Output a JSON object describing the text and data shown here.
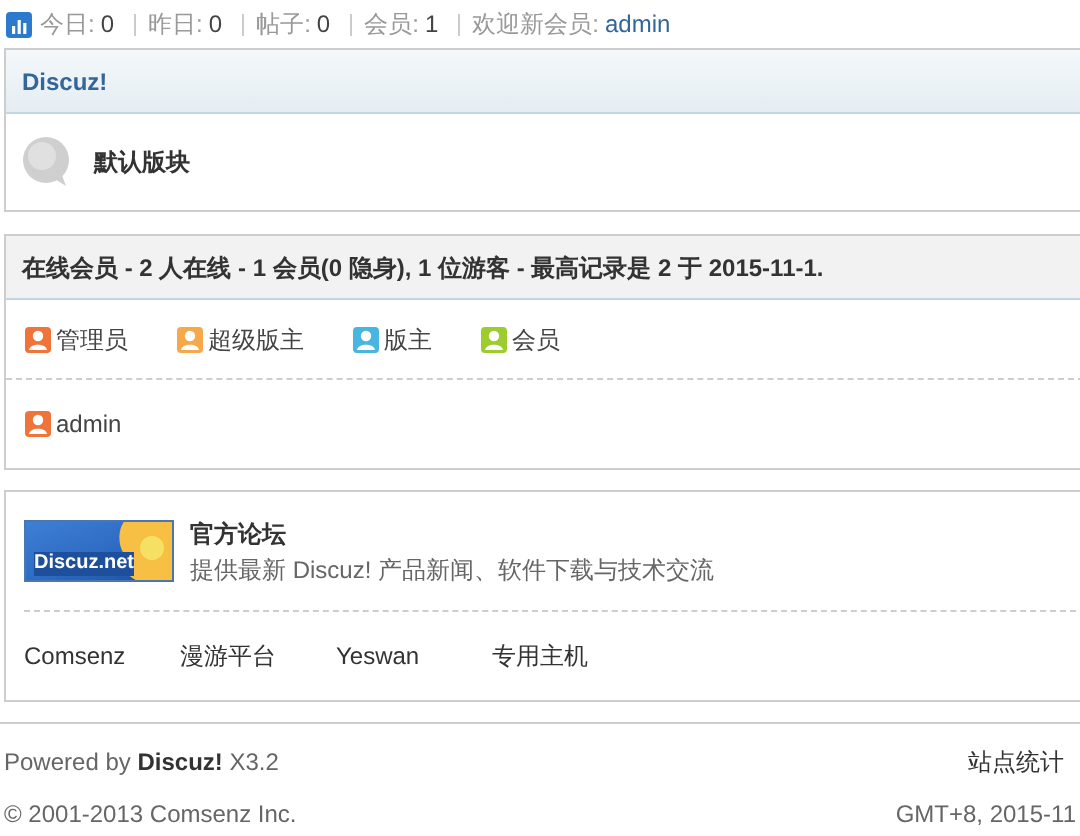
{
  "stats": [
    {
      "label": "今日:",
      "value": "0"
    },
    {
      "label": "昨日:",
      "value": "0"
    },
    {
      "label": "帖子:",
      "value": "0"
    },
    {
      "label": "会员:",
      "value": "1"
    },
    {
      "label": "欢迎新会员:",
      "value": "admin"
    }
  ],
  "category": {
    "title": "Discuz!",
    "forums": [
      {
        "name": "默认版块"
      }
    ]
  },
  "online": {
    "title": "在线会员 - 2 人在线 - 1 会员(0 隐身), 1 位游客 - 最高记录是 2 于 2015-11-1.",
    "legend": [
      {
        "label": "管理员",
        "color": "#f0743a"
      },
      {
        "label": "超级版主",
        "color": "#f5a94a"
      },
      {
        "label": "版主",
        "color": "#48b6e0"
      },
      {
        "label": "会员",
        "color": "#9ccc2e"
      }
    ],
    "users": [
      {
        "name": "admin",
        "color": "#f0743a"
      }
    ]
  },
  "links": {
    "featured": {
      "logo_text": "Discuz.net",
      "title": "官方论坛",
      "description": "提供最新 Discuz! 产品新闻、软件下载与技术交流"
    },
    "items": [
      "Comsenz",
      "漫游平台",
      "Yeswan",
      "专用主机"
    ]
  },
  "footer": {
    "powered_prefix": "Powered by",
    "brand": "Discuz!",
    "version": "X3.2",
    "copyright": "© 2001-2013 Comsenz Inc.",
    "stats_link": "站点统计",
    "timezone": "GMT+8, 2015-11"
  }
}
